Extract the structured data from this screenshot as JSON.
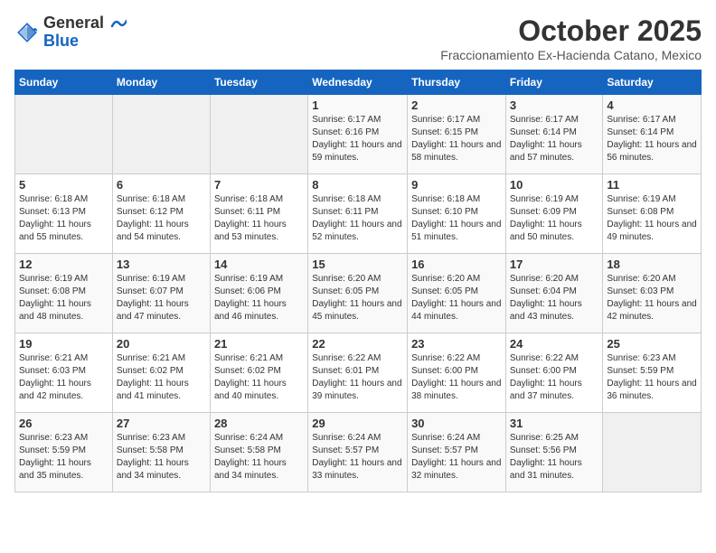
{
  "logo": {
    "general": "General",
    "blue": "Blue"
  },
  "header": {
    "month_title": "October 2025",
    "subtitle": "Fraccionamiento Ex-Hacienda Catano, Mexico"
  },
  "weekdays": [
    "Sunday",
    "Monday",
    "Tuesday",
    "Wednesday",
    "Thursday",
    "Friday",
    "Saturday"
  ],
  "weeks": [
    [
      {
        "day": "",
        "sunrise": "",
        "sunset": "",
        "daylight": ""
      },
      {
        "day": "",
        "sunrise": "",
        "sunset": "",
        "daylight": ""
      },
      {
        "day": "",
        "sunrise": "",
        "sunset": "",
        "daylight": ""
      },
      {
        "day": "1",
        "sunrise": "Sunrise: 6:17 AM",
        "sunset": "Sunset: 6:16 PM",
        "daylight": "Daylight: 11 hours and 59 minutes."
      },
      {
        "day": "2",
        "sunrise": "Sunrise: 6:17 AM",
        "sunset": "Sunset: 6:15 PM",
        "daylight": "Daylight: 11 hours and 58 minutes."
      },
      {
        "day": "3",
        "sunrise": "Sunrise: 6:17 AM",
        "sunset": "Sunset: 6:14 PM",
        "daylight": "Daylight: 11 hours and 57 minutes."
      },
      {
        "day": "4",
        "sunrise": "Sunrise: 6:17 AM",
        "sunset": "Sunset: 6:14 PM",
        "daylight": "Daylight: 11 hours and 56 minutes."
      }
    ],
    [
      {
        "day": "5",
        "sunrise": "Sunrise: 6:18 AM",
        "sunset": "Sunset: 6:13 PM",
        "daylight": "Daylight: 11 hours and 55 minutes."
      },
      {
        "day": "6",
        "sunrise": "Sunrise: 6:18 AM",
        "sunset": "Sunset: 6:12 PM",
        "daylight": "Daylight: 11 hours and 54 minutes."
      },
      {
        "day": "7",
        "sunrise": "Sunrise: 6:18 AM",
        "sunset": "Sunset: 6:11 PM",
        "daylight": "Daylight: 11 hours and 53 minutes."
      },
      {
        "day": "8",
        "sunrise": "Sunrise: 6:18 AM",
        "sunset": "Sunset: 6:11 PM",
        "daylight": "Daylight: 11 hours and 52 minutes."
      },
      {
        "day": "9",
        "sunrise": "Sunrise: 6:18 AM",
        "sunset": "Sunset: 6:10 PM",
        "daylight": "Daylight: 11 hours and 51 minutes."
      },
      {
        "day": "10",
        "sunrise": "Sunrise: 6:19 AM",
        "sunset": "Sunset: 6:09 PM",
        "daylight": "Daylight: 11 hours and 50 minutes."
      },
      {
        "day": "11",
        "sunrise": "Sunrise: 6:19 AM",
        "sunset": "Sunset: 6:08 PM",
        "daylight": "Daylight: 11 hours and 49 minutes."
      }
    ],
    [
      {
        "day": "12",
        "sunrise": "Sunrise: 6:19 AM",
        "sunset": "Sunset: 6:08 PM",
        "daylight": "Daylight: 11 hours and 48 minutes."
      },
      {
        "day": "13",
        "sunrise": "Sunrise: 6:19 AM",
        "sunset": "Sunset: 6:07 PM",
        "daylight": "Daylight: 11 hours and 47 minutes."
      },
      {
        "day": "14",
        "sunrise": "Sunrise: 6:19 AM",
        "sunset": "Sunset: 6:06 PM",
        "daylight": "Daylight: 11 hours and 46 minutes."
      },
      {
        "day": "15",
        "sunrise": "Sunrise: 6:20 AM",
        "sunset": "Sunset: 6:05 PM",
        "daylight": "Daylight: 11 hours and 45 minutes."
      },
      {
        "day": "16",
        "sunrise": "Sunrise: 6:20 AM",
        "sunset": "Sunset: 6:05 PM",
        "daylight": "Daylight: 11 hours and 44 minutes."
      },
      {
        "day": "17",
        "sunrise": "Sunrise: 6:20 AM",
        "sunset": "Sunset: 6:04 PM",
        "daylight": "Daylight: 11 hours and 43 minutes."
      },
      {
        "day": "18",
        "sunrise": "Sunrise: 6:20 AM",
        "sunset": "Sunset: 6:03 PM",
        "daylight": "Daylight: 11 hours and 42 minutes."
      }
    ],
    [
      {
        "day": "19",
        "sunrise": "Sunrise: 6:21 AM",
        "sunset": "Sunset: 6:03 PM",
        "daylight": "Daylight: 11 hours and 42 minutes."
      },
      {
        "day": "20",
        "sunrise": "Sunrise: 6:21 AM",
        "sunset": "Sunset: 6:02 PM",
        "daylight": "Daylight: 11 hours and 41 minutes."
      },
      {
        "day": "21",
        "sunrise": "Sunrise: 6:21 AM",
        "sunset": "Sunset: 6:02 PM",
        "daylight": "Daylight: 11 hours and 40 minutes."
      },
      {
        "day": "22",
        "sunrise": "Sunrise: 6:22 AM",
        "sunset": "Sunset: 6:01 PM",
        "daylight": "Daylight: 11 hours and 39 minutes."
      },
      {
        "day": "23",
        "sunrise": "Sunrise: 6:22 AM",
        "sunset": "Sunset: 6:00 PM",
        "daylight": "Daylight: 11 hours and 38 minutes."
      },
      {
        "day": "24",
        "sunrise": "Sunrise: 6:22 AM",
        "sunset": "Sunset: 6:00 PM",
        "daylight": "Daylight: 11 hours and 37 minutes."
      },
      {
        "day": "25",
        "sunrise": "Sunrise: 6:23 AM",
        "sunset": "Sunset: 5:59 PM",
        "daylight": "Daylight: 11 hours and 36 minutes."
      }
    ],
    [
      {
        "day": "26",
        "sunrise": "Sunrise: 6:23 AM",
        "sunset": "Sunset: 5:59 PM",
        "daylight": "Daylight: 11 hours and 35 minutes."
      },
      {
        "day": "27",
        "sunrise": "Sunrise: 6:23 AM",
        "sunset": "Sunset: 5:58 PM",
        "daylight": "Daylight: 11 hours and 34 minutes."
      },
      {
        "day": "28",
        "sunrise": "Sunrise: 6:24 AM",
        "sunset": "Sunset: 5:58 PM",
        "daylight": "Daylight: 11 hours and 34 minutes."
      },
      {
        "day": "29",
        "sunrise": "Sunrise: 6:24 AM",
        "sunset": "Sunset: 5:57 PM",
        "daylight": "Daylight: 11 hours and 33 minutes."
      },
      {
        "day": "30",
        "sunrise": "Sunrise: 6:24 AM",
        "sunset": "Sunset: 5:57 PM",
        "daylight": "Daylight: 11 hours and 32 minutes."
      },
      {
        "day": "31",
        "sunrise": "Sunrise: 6:25 AM",
        "sunset": "Sunset: 5:56 PM",
        "daylight": "Daylight: 11 hours and 31 minutes."
      },
      {
        "day": "",
        "sunrise": "",
        "sunset": "",
        "daylight": ""
      }
    ]
  ]
}
